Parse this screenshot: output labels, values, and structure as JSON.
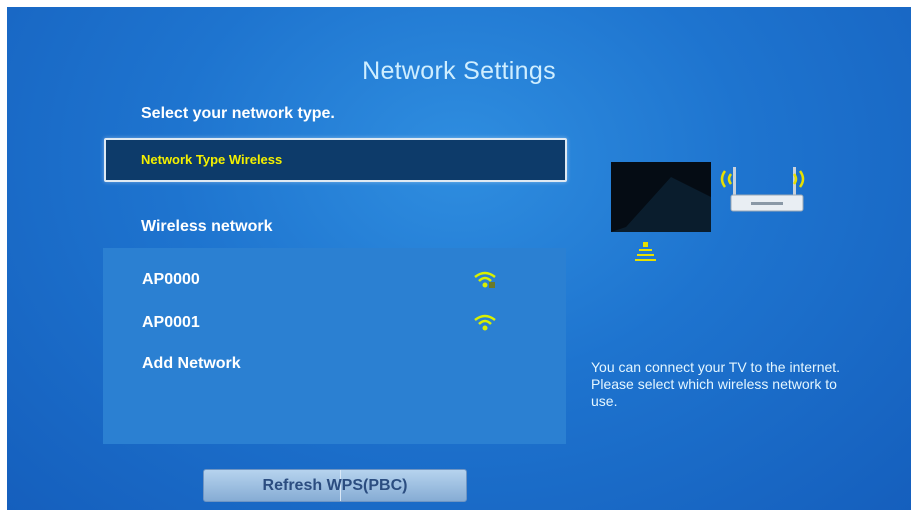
{
  "screen": {
    "title": "Network Settings",
    "subtitle": "Select your network type.",
    "network_type": "Network Type Wireless",
    "wireless_label": "Wireless network",
    "networks": [
      {
        "label": "AP0000",
        "signal_icon": "wifi-signal-icon"
      },
      {
        "label": "AP0001",
        "signal_icon": "wifi-signal-icon"
      },
      {
        "label": "Add Network"
      }
    ],
    "refresh_button": "Refresh WPS(PBC)",
    "info_text": "You can connect your TV to the internet. Please select which wireless network to use."
  },
  "colors": {
    "background": "#1e74cf",
    "highlight_text": "#f4f000",
    "wifi_icon": "#d9f000"
  }
}
